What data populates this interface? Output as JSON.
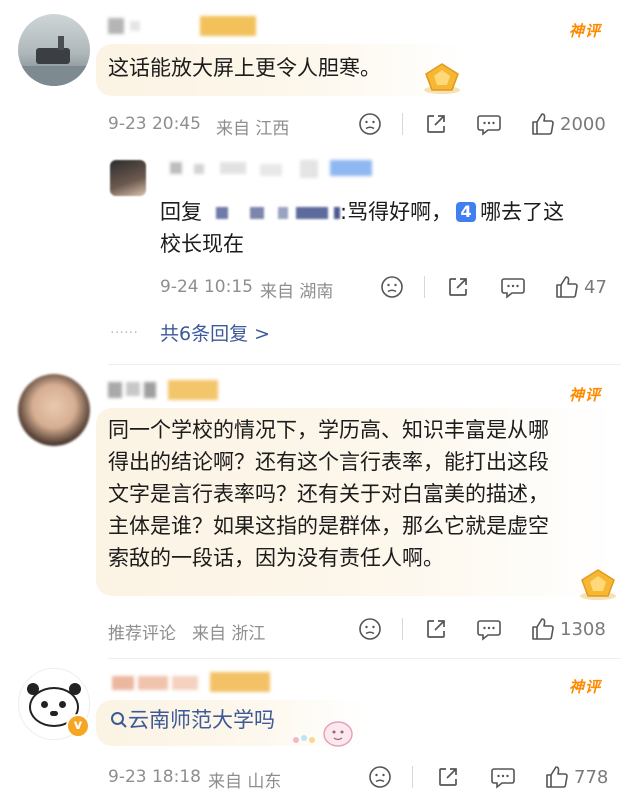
{
  "comments": [
    {
      "badge": "神评",
      "text": "这话能放大屏上更令人胆寒。",
      "time": "9-23 20:45",
      "location": "来自 江西",
      "likes": "2000"
    },
    {
      "badge": "神评",
      "text": "同一个学校的情况下，学历高、知识丰富是从哪得出的结论啊？还有这个言行表率，能打出这段文字是言行表率吗？还有关于对白富美的描述，主体是谁？如果这指的是群体，那么它就是虚空索敌的一段话，因为没有责任人啊。",
      "lines": [
        "同一个学校的情况下，学历高、知识丰富是从哪",
        "得出的结论啊？还有这个言行表率，能打出这段",
        "文字是言行表率吗？还有关于对白富美的描述，",
        "主体是谁？如果这指的是群体，那么它就是虚空",
        "索敌的一段话，因为没有责任人啊。"
      ],
      "time": "推荐评论",
      "location": "来自 浙江",
      "likes": "1308"
    },
    {
      "badge": "神评",
      "text": "云南师范大学吗",
      "time": "9-23 18:18",
      "location": "来自 山东",
      "likes": "778"
    }
  ],
  "reply": {
    "prefix": "回复",
    "text_after_name": ":骂得好啊，",
    "number_tile": "4",
    "text_tail": "哪去了这",
    "line2": "校长现在",
    "time": "9-24 10:15",
    "location": "来自 湖南",
    "likes": "47"
  },
  "more_replies": {
    "dots": "……",
    "label": "共6条回复 >"
  },
  "colors": {
    "badge_orange": "#ff8a00",
    "link_blue": "#3d5a98",
    "meta_gray": "#8e8e8e",
    "verified_orange": "#f5a623"
  },
  "icons": [
    "emoji-face-icon",
    "share-icon",
    "comment-icon",
    "thumbs-up-icon",
    "search-icon",
    "gem-icon",
    "verified-v-icon"
  ]
}
